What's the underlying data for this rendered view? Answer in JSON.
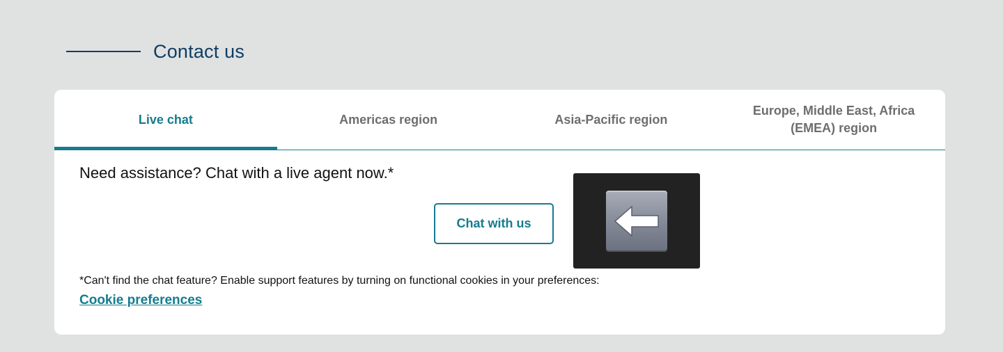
{
  "page": {
    "title": "Contact us"
  },
  "tabs": [
    {
      "label": "Live chat",
      "active": true
    },
    {
      "label": "Americas region",
      "active": false
    },
    {
      "label": "Asia-Pacific region",
      "active": false
    },
    {
      "label": "Europe, Middle East, Africa (EMEA) region",
      "active": false
    }
  ],
  "live_chat": {
    "heading": "Need assistance? Chat with a live agent now.*",
    "button_label": "Chat with us",
    "image_icon": "left-arrow-key-icon",
    "cookie_note": "*Can't find the chat feature? Enable support features by turning on functional cookies in your preferences:",
    "cookie_link": "Cookie preferences"
  },
  "colors": {
    "background": "#e0e1e1",
    "heading": "#0e3e63",
    "accent": "#157c8f",
    "inactive_tab": "#6e6e6e",
    "card": "#ffffff"
  }
}
